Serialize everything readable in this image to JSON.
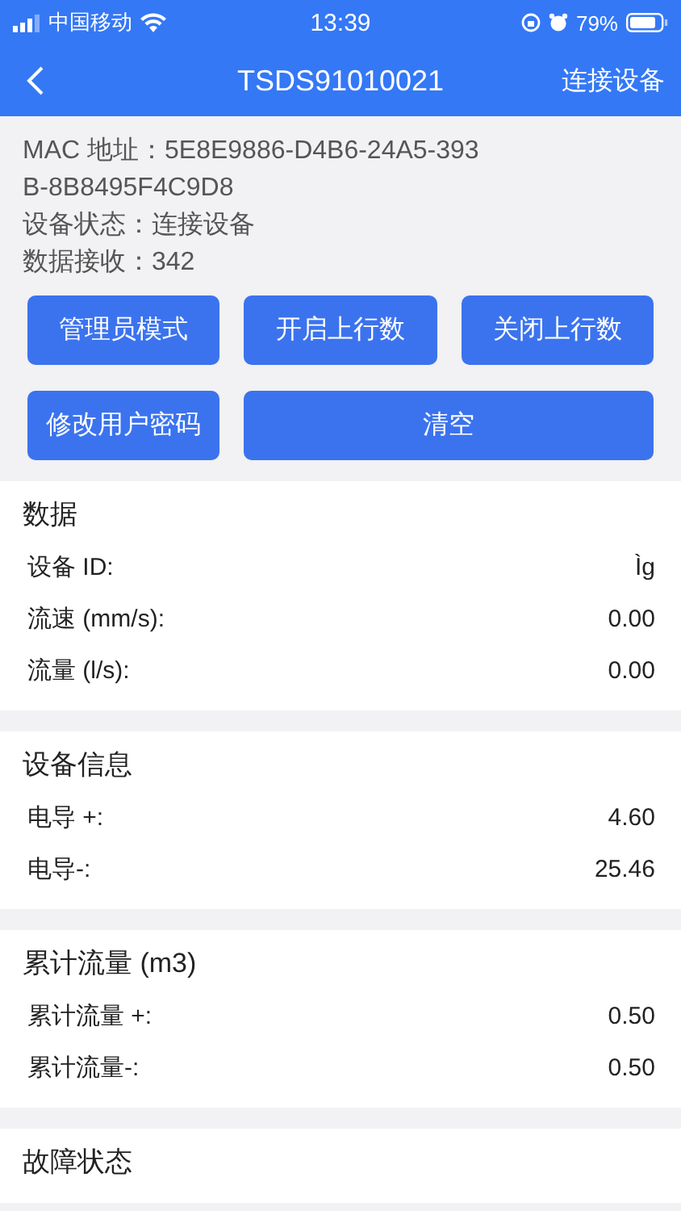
{
  "status_bar": {
    "carrier": "中国移动",
    "time": "13:39",
    "battery": "79%"
  },
  "nav": {
    "title": "TSDS91010021",
    "action": "连接设备"
  },
  "info": [
    {
      "label": "MAC 地址：",
      "value": "5E8E9886-D4B6-24A5-393B-8B8495F4C9D8"
    },
    {
      "label": "设备状态：",
      "value": "连接设备"
    },
    {
      "label": "数据接收：",
      "value": "342"
    }
  ],
  "buttons": [
    {
      "label": "管理员模式",
      "wide": false
    },
    {
      "label": "开启上行数",
      "wide": false
    },
    {
      "label": "关闭上行数",
      "wide": false
    },
    {
      "label": "修改用户密码",
      "wide": false
    },
    {
      "label": "清空",
      "wide": true
    }
  ],
  "sections": [
    {
      "title": "数据",
      "rows": [
        {
          "label": "设备 ID:",
          "value": "Ìg"
        },
        {
          "label": "流速 (mm/s):",
          "value": "0.00"
        },
        {
          "label": "流量 (l/s):",
          "value": "0.00"
        }
      ]
    },
    {
      "title": "设备信息",
      "rows": [
        {
          "label": "电导 +:",
          "value": "4.60"
        },
        {
          "label": "电导-:",
          "value": "25.46"
        }
      ]
    },
    {
      "title": "累计流量 (m3)",
      "rows": [
        {
          "label": "累计流量 +:",
          "value": "0.50"
        },
        {
          "label": "累计流量-:",
          "value": "0.50"
        }
      ]
    },
    {
      "title": "故障状态"
    }
  ]
}
